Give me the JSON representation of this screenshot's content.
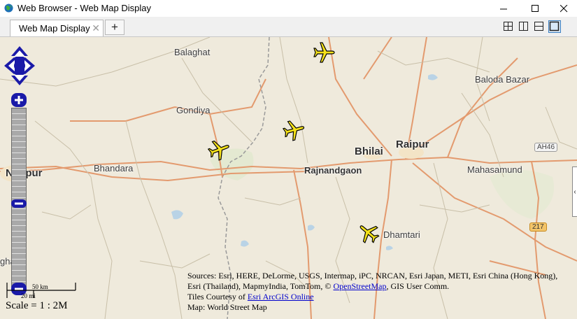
{
  "window": {
    "title": "Web Browser - Web Map Display",
    "minimize_symbol": "—",
    "close_symbol": "✕"
  },
  "tabs": [
    {
      "label": "Web Map Display",
      "close_symbol": "✕"
    }
  ],
  "add_tab_symbol": "+",
  "map": {
    "places": {
      "balaghat": "Balaghat",
      "gondiya": "Gondiya",
      "nagpur": "Nagpur",
      "bhandara": "Bhandara",
      "bhilai": "Bhilai",
      "raipur": "Raipur",
      "rajnandgaon": "Rajnandgaon",
      "baloda_bazar": "Baloda Bazar",
      "mahasamund": "Mahasamund",
      "dhamtari": "Dhamtari",
      "ghat_partial": "ghat"
    },
    "highway_shields": {
      "ah46": "AH46",
      "n217": "217"
    },
    "scale": {
      "km_label": "50 km",
      "mi_label": "20 mi",
      "text": "Scale = 1 : 2M"
    },
    "attribution": {
      "line1": "Sources: Esri, HERE, DeLorme, USGS, Intermap, iPC, NRCAN, Esri Japan, METI, Esri China (Hong Kong),",
      "line2_prefix": "Esri (Thailand), MapmyIndia, TomTom, ©",
      "line2_link": "OpenStreetMap",
      "line2_suffix": ", GIS User Comm.",
      "line3_prefix": "Tiles Courtesy of",
      "line3_link": "Esri ArcGIS Online",
      "line4": "Map: World Street Map"
    },
    "plane_color": "#f5e21a",
    "road_color": "#e39a6e",
    "boundary_color": "#8f8f8f"
  },
  "controls": {
    "zoom_in_symbol": "+",
    "zoom_out_symbol": "−",
    "side_panel_symbol": "‹"
  }
}
